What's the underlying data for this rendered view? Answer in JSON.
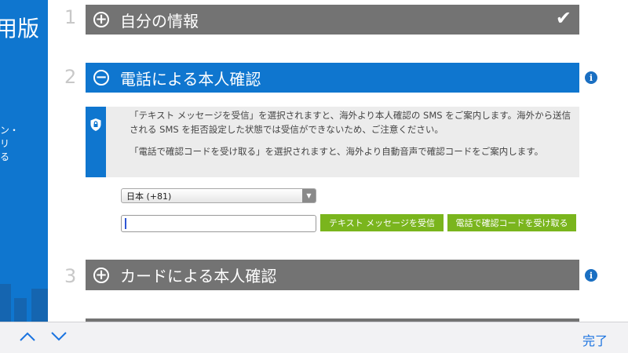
{
  "left_panel": {
    "title": "用版",
    "lines": [
      "ン・",
      "リ",
      "る"
    ]
  },
  "steps": [
    {
      "number": "1",
      "title": "自分の情報",
      "state": "completed",
      "toggle": "+"
    },
    {
      "number": "2",
      "title": "電話による本人確認",
      "state": "active",
      "toggle": "−"
    },
    {
      "number": "3",
      "title": "カードによる本人確認",
      "state": "collapsed",
      "toggle": "+"
    }
  ],
  "notice": {
    "paragraph1": "「テキスト メッセージを受信」を選択されますと、海外より本人確認の SMS をご案内します。海外から送信される SMS を拒否設定した状態では受信ができないため、ご注意ください。",
    "paragraph2": "「電話で確認コードを受け取る」を選択されますと、海外より自動音声で確認コードをご案内します。"
  },
  "form": {
    "country_selected": "日本 (+81)",
    "phone_value": "",
    "sms_button_label": "テキスト メッセージを受信",
    "call_button_label": "電話で確認コードを受け取る"
  },
  "toolbar": {
    "done_label": "完了"
  },
  "icons": {
    "completed": "checkmark-icon",
    "info": "info-icon",
    "notice": "shield-icon"
  },
  "colors": {
    "accent_blue": "#0f76cf",
    "section_gray": "#737373",
    "button_green": "#7ab51d",
    "link_blue": "#1a73e0"
  }
}
